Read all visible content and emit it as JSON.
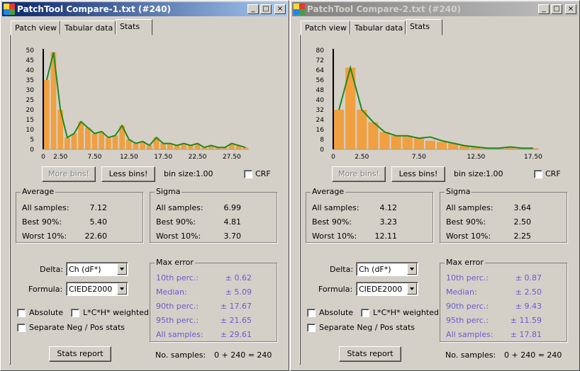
{
  "windows": [
    {
      "title": "PatchTool Compare-1.txt (#240)",
      "tabs": [
        "Patch view",
        "Tabular data",
        "Stats"
      ],
      "active_tab": "Stats",
      "buttons": {
        "more_bins": "More bins!",
        "less_bins": "Less bins!",
        "stats_report": "Stats report"
      },
      "bin_size_label": "bin size:",
      "bin_size_value": "1.00",
      "crf_label": "CRF",
      "average": {
        "title": "Average",
        "rows": [
          {
            "label": "All samples:",
            "value": "7.12"
          },
          {
            "label": "Best 90%:",
            "value": "5.40"
          },
          {
            "label": "Worst 10%:",
            "value": "22.60"
          }
        ]
      },
      "sigma": {
        "title": "Sigma",
        "rows": [
          {
            "label": "All samples:",
            "value": "6.99"
          },
          {
            "label": "Best 90%:",
            "value": "4.81"
          },
          {
            "label": "Worst 10%:",
            "value": "3.70"
          }
        ]
      },
      "delta_label": "Delta:",
      "delta_value": "Ch (dF*)",
      "formula_label": "Formula:",
      "formula_value": "CIEDE2000",
      "absolute_label": "Absolute",
      "lch_label": "L*C*H* weighted",
      "separate_label": "Separate Neg / Pos stats",
      "max_error": {
        "title": "Max error",
        "rows": [
          {
            "label": "10th perc.:",
            "value": "± 0.62"
          },
          {
            "label": "Median:",
            "value": "± 5.09"
          },
          {
            "label": "90th perc.:",
            "value": "± 17.67"
          },
          {
            "label": "95th perc.:",
            "value": "± 21.65"
          },
          {
            "label": "All samples:",
            "value": "± 29.61"
          }
        ]
      },
      "no_samples_label": "No. samples:",
      "no_samples_value": "0 + 240 = 240",
      "chart_data": {
        "type": "bar",
        "x_ticks": [
          "0",
          "2.50",
          "7.50",
          "12.50",
          "17.50",
          "22.50",
          "27.50"
        ],
        "y_ticks": [
          "0",
          "5",
          "10",
          "15",
          "20",
          "25",
          "30",
          "35",
          "40",
          "45",
          "50"
        ],
        "ylim": [
          0,
          50
        ],
        "xlim": [
          0,
          30
        ],
        "bar_values": [
          35,
          49,
          20,
          6,
          8,
          14,
          11,
          8,
          9,
          6,
          7,
          12,
          5,
          3,
          4,
          2,
          6,
          3,
          3,
          2,
          3,
          2,
          3,
          1,
          2,
          1,
          1,
          3,
          2,
          1
        ],
        "line_values": [
          35,
          49,
          20,
          6,
          8,
          14,
          11,
          8,
          9,
          6,
          7,
          12,
          5,
          3,
          4,
          2,
          6,
          3,
          3,
          2,
          3,
          2,
          3,
          1,
          2,
          1,
          1,
          3,
          2,
          1
        ],
        "bar_color": "#f0a040",
        "line_color": "#1e8a1e",
        "grid": false
      }
    },
    {
      "title": "PatchTool Compare-2.txt (#240)",
      "tabs": [
        "Patch view",
        "Tabular data",
        "Stats"
      ],
      "active_tab": "Stats",
      "buttons": {
        "more_bins": "More bins!",
        "less_bins": "Less bins!",
        "stats_report": "Stats report"
      },
      "bin_size_label": "bin size:",
      "bin_size_value": "1.00",
      "crf_label": "CRF",
      "average": {
        "title": "Average",
        "rows": [
          {
            "label": "All samples:",
            "value": "4.12"
          },
          {
            "label": "Best 90%:",
            "value": "3.23"
          },
          {
            "label": "Worst 10%:",
            "value": "12.11"
          }
        ]
      },
      "sigma": {
        "title": "Sigma",
        "rows": [
          {
            "label": "All samples:",
            "value": "3.64"
          },
          {
            "label": "Best 90%:",
            "value": "2.50"
          },
          {
            "label": "Worst 10%:",
            "value": "2.25"
          }
        ]
      },
      "delta_label": "Delta:",
      "delta_value": "Ch (dF*)",
      "formula_label": "Formula:",
      "formula_value": "CIEDE2000",
      "absolute_label": "Absolute",
      "lch_label": "L*C*H* weighted",
      "separate_label": "Separate Neg / Pos stats",
      "max_error": {
        "title": "Max error",
        "rows": [
          {
            "label": "10th perc.:",
            "value": "± 0.87"
          },
          {
            "label": "Median:",
            "value": "± 2.50"
          },
          {
            "label": "90th perc.:",
            "value": "± 9.43"
          },
          {
            "label": "95th perc.:",
            "value": "± 11.59"
          },
          {
            "label": "All samples:",
            "value": "± 17.81"
          }
        ]
      },
      "no_samples_label": "No. samples:",
      "no_samples_value": "0 + 240 = 240",
      "chart_data": {
        "type": "bar",
        "x_ticks": [
          "0",
          "2.50",
          "7.50",
          "12.50",
          "17.50"
        ],
        "y_ticks": [
          "0",
          "8",
          "16",
          "24",
          "32",
          "40",
          "48",
          "56",
          "64",
          "72",
          "80"
        ],
        "ylim": [
          0,
          80
        ],
        "xlim": [
          0,
          18
        ],
        "bar_values": [
          32,
          66,
          32,
          22,
          14,
          11,
          11,
          9,
          7,
          6,
          5,
          3,
          2,
          1,
          1,
          2,
          1,
          1
        ],
        "line_values": [
          32,
          66,
          32,
          22,
          14,
          11,
          11,
          9,
          10,
          7,
          5,
          3,
          2,
          1,
          1,
          2,
          1,
          1
        ],
        "bar_color": "#f0a040",
        "line_color": "#1e8a1e",
        "grid": false
      }
    }
  ]
}
